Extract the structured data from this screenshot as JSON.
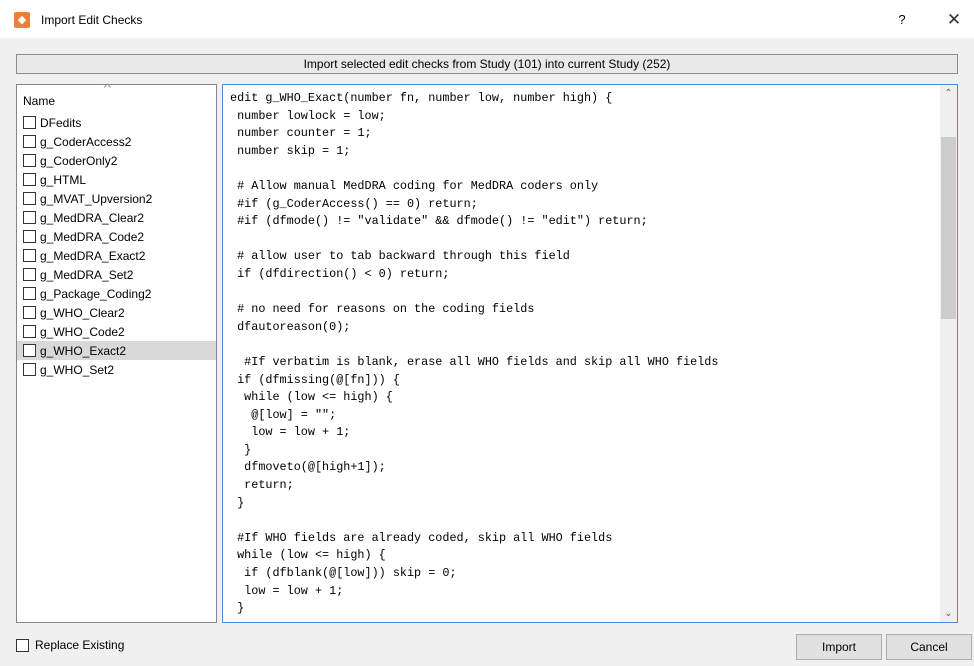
{
  "window": {
    "title": "Import Edit Checks",
    "help": "?",
    "close": "✕",
    "app_icon": "app-icon"
  },
  "banner": "Import selected edit checks from Study (101) into current Study (252)",
  "list": {
    "header": "Name",
    "sort_glyph": "^",
    "items": [
      {
        "label": "DFedits",
        "checked": false,
        "selected": false
      },
      {
        "label": "g_CoderAccess2",
        "checked": false,
        "selected": false
      },
      {
        "label": "g_CoderOnly2",
        "checked": false,
        "selected": false
      },
      {
        "label": "g_HTML",
        "checked": false,
        "selected": false
      },
      {
        "label": "g_MVAT_Upversion2",
        "checked": false,
        "selected": false
      },
      {
        "label": "g_MedDRA_Clear2",
        "checked": false,
        "selected": false
      },
      {
        "label": "g_MedDRA_Code2",
        "checked": false,
        "selected": false
      },
      {
        "label": "g_MedDRA_Exact2",
        "checked": false,
        "selected": false
      },
      {
        "label": "g_MedDRA_Set2",
        "checked": false,
        "selected": false
      },
      {
        "label": "g_Package_Coding2",
        "checked": false,
        "selected": false
      },
      {
        "label": "g_WHO_Clear2",
        "checked": false,
        "selected": false
      },
      {
        "label": "g_WHO_Code2",
        "checked": false,
        "selected": false
      },
      {
        "label": "g_WHO_Exact2",
        "checked": false,
        "selected": true
      },
      {
        "label": "g_WHO_Set2",
        "checked": false,
        "selected": false
      }
    ]
  },
  "code": {
    "lines": [
      "edit g_WHO_Exact(number fn, number low, number high) {",
      " number lowlock = low;",
      " number counter = 1;",
      " number skip = 1;",
      "",
      " # Allow manual MedDRA coding for MedDRA coders only",
      " #if (g_CoderAccess() == 0) return;",
      " #if (dfmode() != \"validate\" && dfmode() != \"edit\") return;",
      "",
      " # allow user to tab backward through this field",
      " if (dfdirection() < 0) return;",
      "",
      " # no need for reasons on the coding fields",
      " dfautoreason(0);",
      "",
      "  #If verbatim is blank, erase all WHO fields and skip all WHO fields",
      " if (dfmissing(@[fn])) {",
      "  while (low <= high) {",
      "   @[low] = \"\";",
      "   low = low + 1;",
      "  }",
      "  dfmoveto(@[high+1]);",
      "  return;",
      " }",
      "",
      " #If WHO fields are already coded, skip all WHO fields",
      " while (low <= high) {",
      "  if (dfblank(@[low])) skip = 0;",
      "  low = low + 1;",
      " }"
    ]
  },
  "footer": {
    "replace_label": "Replace Existing",
    "replace_checked": false,
    "import_label": "Import",
    "cancel_label": "Cancel"
  },
  "scrollbar": {
    "up_glyph": "^",
    "down_glyph": "v"
  }
}
